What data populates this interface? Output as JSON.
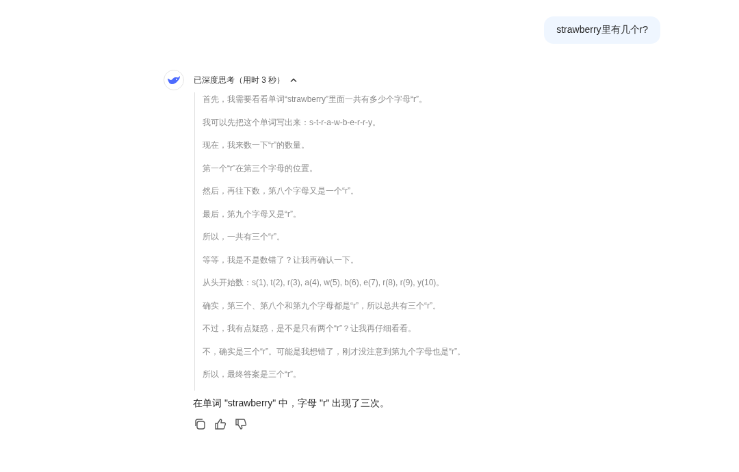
{
  "user_message": "strawberry里有几个r?",
  "thinking": {
    "label": "已深度思考（用时 3 秒）",
    "expanded": true,
    "paragraphs": [
      "首先，我需要看看单词“strawberry”里面一共有多少个字母“r”。",
      "我可以先把这个单词写出来：s-t-r-a-w-b-e-r-r-y。",
      "现在，我来数一下“r”的数量。",
      "第一个“r”在第三个字母的位置。",
      "然后，再往下数，第八个字母又是一个“r”。",
      "最后，第九个字母又是“r”。",
      "所以，一共有三个“r”。",
      "等等，我是不是数错了？让我再确认一下。",
      "从头开始数：s(1), t(2), r(3), a(4), w(5), b(6), e(7), r(8), r(9), y(10)。",
      "确实，第三个、第八个和第九个字母都是“r”，所以总共有三个“r”。",
      "不过，我有点疑惑，是不是只有两个“r”？让我再仔细看看。",
      "不，确实是三个“r”。可能是我想错了，刚才没注意到第九个字母也是“r”。",
      "所以，最终答案是三个“r”。"
    ]
  },
  "answer": "在单词 \"strawberry\" 中，字母 \"r\" 出现了三次。"
}
